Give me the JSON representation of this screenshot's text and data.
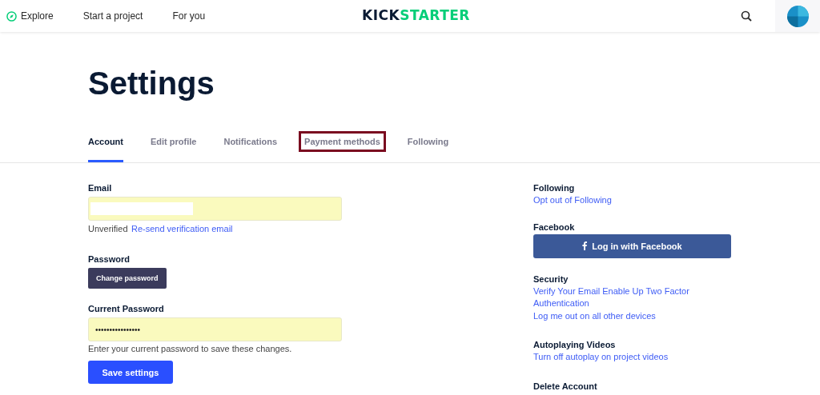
{
  "nav": {
    "links": [
      {
        "label": "Explore",
        "kind": "with-icon"
      },
      {
        "label": "Start a project"
      },
      {
        "label": "For you"
      }
    ],
    "logo": {
      "dark": "KICK",
      "green": "STARTER"
    }
  },
  "page": {
    "title": "Settings"
  },
  "tabs": [
    {
      "label": "Account",
      "selected": true,
      "highlighted": false
    },
    {
      "label": "Edit profile",
      "selected": false,
      "highlighted": false
    },
    {
      "label": "Notifications",
      "selected": false,
      "highlighted": false
    },
    {
      "label": "Payment methods",
      "selected": false,
      "highlighted": true
    },
    {
      "label": "Following",
      "selected": false,
      "highlighted": false
    }
  ],
  "account": {
    "email": {
      "label": "Email",
      "status": "Unverified",
      "link": "Re-send verification email"
    },
    "password": {
      "label": "Password",
      "button": "Change password"
    },
    "current_password": {
      "label": "Current Password",
      "value": "••••••••••••••••",
      "hint": "Enter your current password to save these changes."
    },
    "save": "Save settings"
  },
  "side": [
    {
      "title": "Following",
      "kind": "links",
      "links": [
        "Opt out of Following"
      ]
    },
    {
      "title": "Facebook",
      "kind": "button",
      "button": "Log in with Facebook"
    },
    {
      "title": "Security",
      "kind": "links",
      "links": [
        "Verify Your Email Enable Up Two Factor Authentication",
        "Log me out on all other devices"
      ]
    },
    {
      "title": "Autoplaying Videos",
      "kind": "links",
      "links": [
        "Turn off autoplay on project videos"
      ]
    },
    {
      "title": "Delete Account",
      "kind": "title"
    }
  ]
}
